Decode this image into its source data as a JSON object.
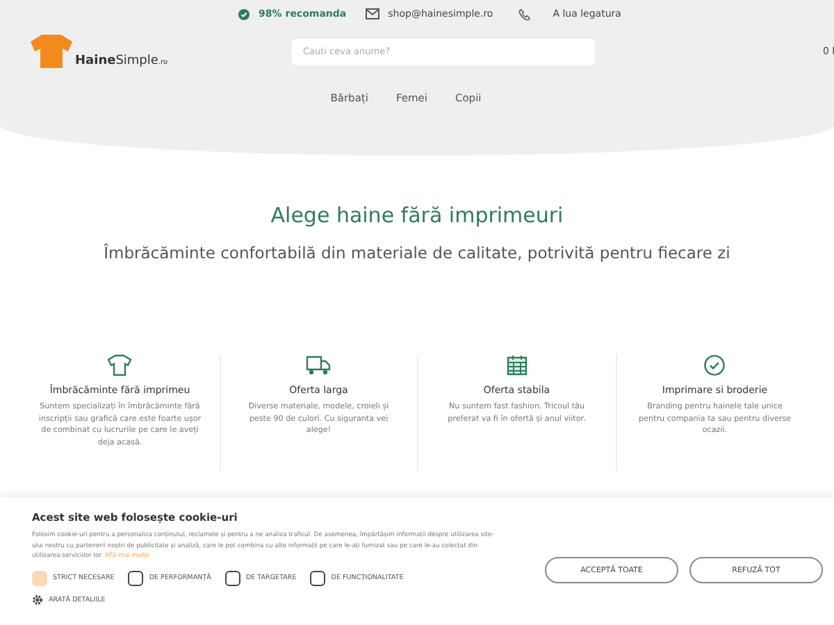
{
  "topbar": {
    "rating": "98% recomanda",
    "email": "shop@hainesimple.ro",
    "phone_label": "A lua legatura"
  },
  "logo": {
    "name_bold": "Haine",
    "name_light": "Simple",
    "suffix": ".ro"
  },
  "search": {
    "placeholder": "Cauti ceva anume?"
  },
  "cart": {
    "total": "0 l"
  },
  "nav": [
    "Bărbați",
    "Femei",
    "Copii"
  ],
  "hero": {
    "title": "Alege haine fără imprimeuri",
    "subtitle": "Îmbrăcăminte confortabilă din materiale de calitate, potrivită pentru fiecare zi"
  },
  "features": [
    {
      "title": "Îmbrăcăminte fără imprimeu",
      "text": "Suntem specializați în îmbrăcăminte fără inscripții sau grafică care este foarte ușor de combinat cu lucrurile pe care le aveți deja acasă."
    },
    {
      "title": "Oferta larga",
      "text": "Diverse materiale, modele, croieli și peste 90 de culori. Cu siguranta vei alege!"
    },
    {
      "title": "Oferta stabila",
      "text": "Nu suntem fast fashion. Tricoul tău preferat va fi în ofertă și anul viitor."
    },
    {
      "title": "Imprimare si broderie",
      "text": "Branding pentru hainele tale unice pentru compania ta sau pentru diverse ocazii."
    }
  ],
  "cookie": {
    "title": "Acest site web folosește cookie-uri",
    "text": "Folosim cookie-uri pentru a personaliza conținutul, reclamele și pentru a ne analiza traficul. De asemenea, împărtășim informații despre utilizarea site-ului nostru cu partenerii noștri de publicitate și analiză, care le pot combina cu alte informații pe care le-ați furnizat sau pe care le-au colectat din utilizarea serviciilor lor.",
    "link": "Află mai multe",
    "options": [
      {
        "label": "STRICT NECESARE",
        "checked": true
      },
      {
        "label": "DE PERFORMANȚĂ",
        "checked": false
      },
      {
        "label": "DE TARGETARE",
        "checked": false
      },
      {
        "label": "DE FUNCȚIONALITATE",
        "checked": false
      }
    ],
    "details": "ARATĂ DETALIILE",
    "buttons": [
      "ACCEPTĂ TOATE",
      "REFUZĂ TOT"
    ]
  }
}
